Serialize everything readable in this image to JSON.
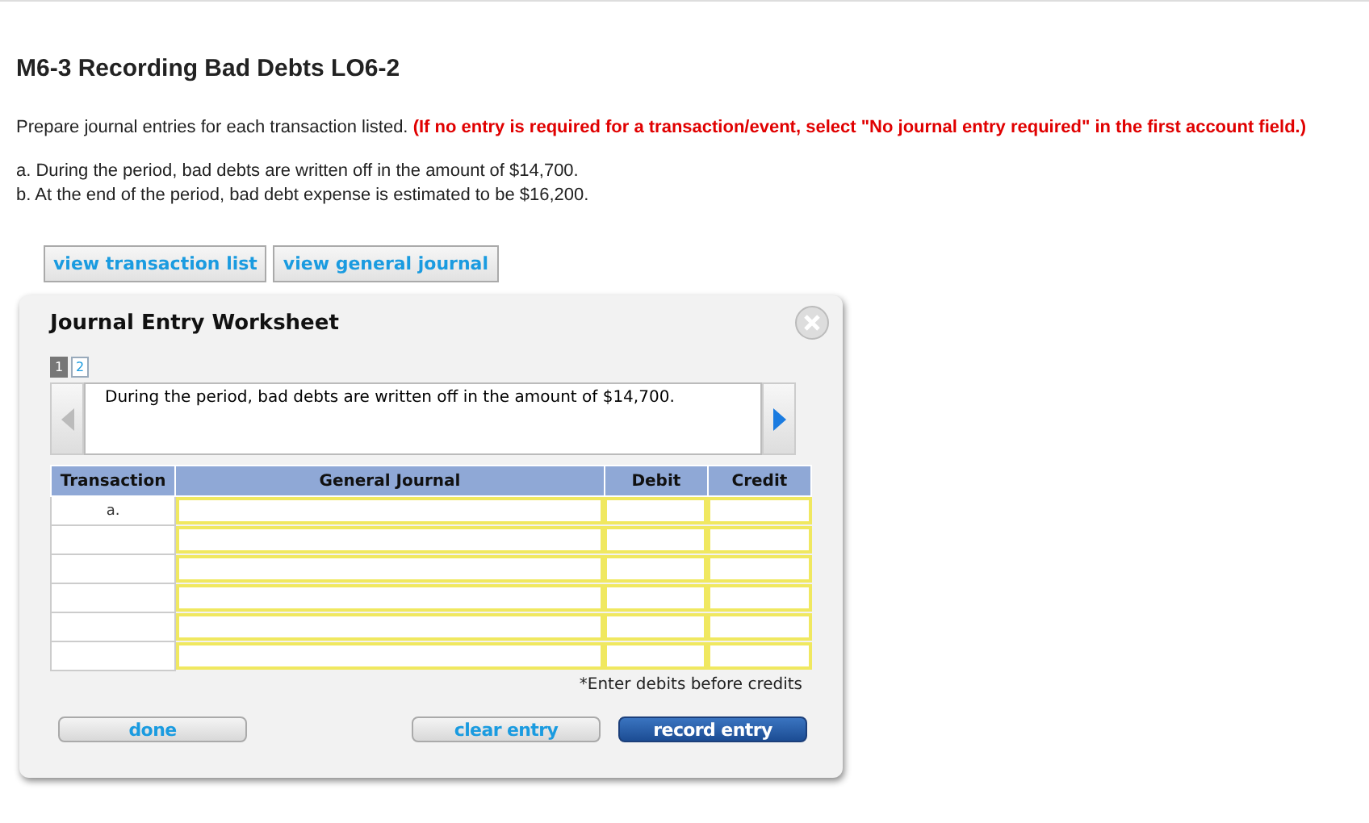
{
  "heading": "M6-3 Recording Bad Debts LO6-2",
  "instructions": "Prepare journal entries for each transaction listed. **(If no entry is required for a transaction/event, select \"No journal entry required\" in the first account field.)**",
  "transactions": [
    "a. During the period, bad debts are written off in the amount of $14,700.",
    "b. At the end of the period, bad debt expense is estimated to be $16,200."
  ],
  "view_buttons": [
    "view transaction list",
    "view general journal"
  ],
  "worksheet": {
    "title": "Journal Entry Worksheet",
    "pages": [
      {
        "label": "1",
        "selected": true
      },
      {
        "label": "2",
        "selected": false
      }
    ],
    "description": "During the period, bad debts are written off in the amount of $14,700.",
    "table": {
      "columns": [
        "Transaction",
        "General Journal",
        "Debit",
        "Credit"
      ],
      "rows": [
        {
          "transaction": "a."
        },
        {},
        {},
        {},
        {},
        {}
      ]
    },
    "note": "*Enter debits before credits",
    "buttons": [
      {
        "label": "done",
        "kind": "plain"
      },
      {
        "label": "clear entry",
        "kind": "plain"
      },
      {
        "label": "record entry",
        "kind": "primary"
      }
    ]
  }
}
